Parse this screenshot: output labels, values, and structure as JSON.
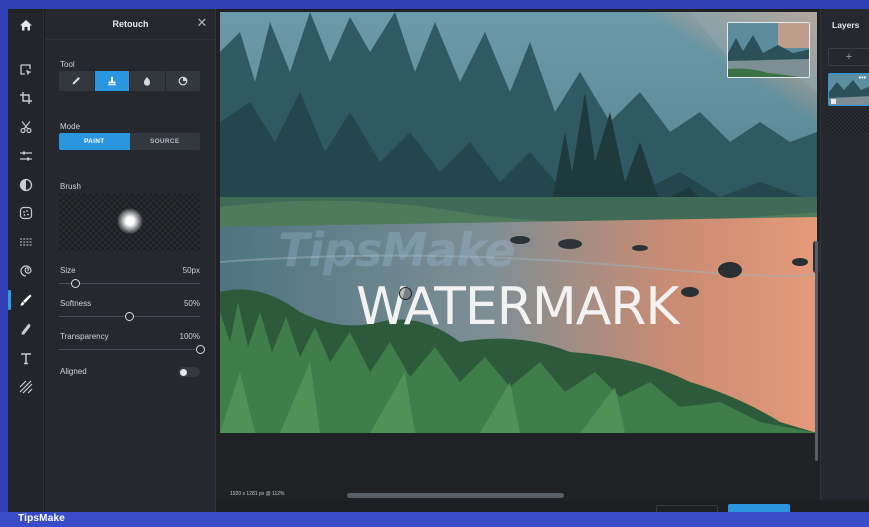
{
  "frame": {
    "brand": "TipsMake"
  },
  "toolbar": {
    "items": [
      {
        "icon": "home-icon"
      },
      {
        "icon": "select-arrange-icon"
      },
      {
        "icon": "crop-icon"
      },
      {
        "icon": "cutout-scissors-icon"
      },
      {
        "icon": "adjust-sliders-icon"
      },
      {
        "icon": "contrast-circle-icon"
      },
      {
        "icon": "effects-icon"
      },
      {
        "icon": "filters-icon"
      },
      {
        "icon": "liquify-icon"
      },
      {
        "icon": "retouch-brush-icon",
        "active": true
      },
      {
        "icon": "draw-pen-icon"
      },
      {
        "icon": "text-icon"
      },
      {
        "icon": "texture-icon"
      }
    ]
  },
  "panel": {
    "title": "Retouch",
    "tool_label": "Tool",
    "tools": [
      {
        "icon": "heal-pencil-icon",
        "active": false
      },
      {
        "icon": "clone-stamp-icon",
        "active": true
      },
      {
        "icon": "blur-drop-icon",
        "active": false
      },
      {
        "icon": "sponge-icon",
        "active": false
      }
    ],
    "mode_label": "Mode",
    "modes": [
      {
        "label": "PAINT",
        "active": true
      },
      {
        "label": "SOURCE",
        "active": false
      }
    ],
    "brush_label": "Brush",
    "size": {
      "label": "Size",
      "value": "50px",
      "level": 0.12
    },
    "softness": {
      "label": "Softness",
      "value": "50%",
      "level": 0.5
    },
    "transparency": {
      "label": "Transparency",
      "value": "100%",
      "level": 1.0
    },
    "aligned": {
      "label": "Aligned",
      "on": false
    }
  },
  "canvas": {
    "watermark_text": "WATERMARK",
    "ghost_watermark": "TipsMake",
    "info": "1920 x 1281 px @ 112%"
  },
  "layers": {
    "title": "Layers",
    "add_label": "+",
    "more_label": "•••"
  },
  "colors": {
    "accent": "#2a96e0",
    "frame": "#2f3fb4",
    "panel": "#25282e"
  }
}
